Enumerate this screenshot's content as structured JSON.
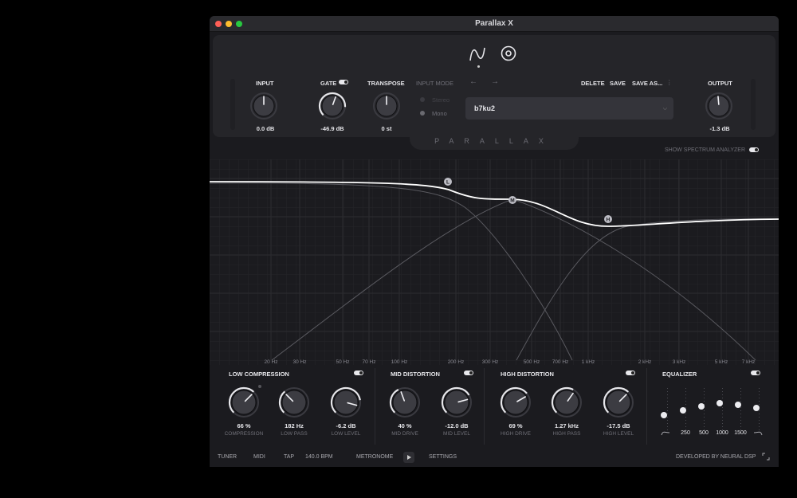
{
  "window": {
    "title": "Parallax X"
  },
  "brand": "PARALLAX",
  "header": {
    "input": {
      "label": "INPUT",
      "value": "0.0 dB"
    },
    "gate": {
      "label": "GATE",
      "value": "-46.9 dB",
      "enabled": true
    },
    "transpose": {
      "label": "TRANSPOSE",
      "value": "0 st"
    },
    "input_mode": {
      "label": "INPUT MODE",
      "options": [
        "Stereo",
        "Mono"
      ],
      "selected": "Mono"
    },
    "nav": {
      "back": "←",
      "forward": "→"
    },
    "actions": {
      "delete": "DELETE",
      "save": "SAVE",
      "save_as": "SAVE AS...",
      "more": "⋮"
    },
    "preset": {
      "name": "b7ku2"
    },
    "output": {
      "label": "OUTPUT",
      "value": "-1.3 dB"
    }
  },
  "analyzer": {
    "show_spectrum_label": "SHOW SPECTRUM ANALYZER",
    "show_spectrum_enabled": true,
    "freq_labels": [
      "20 Hz",
      "30 Hz",
      "50 Hz",
      "70 Hz",
      "100 Hz",
      "200 Hz",
      "300 Hz",
      "500 Hz",
      "700 Hz",
      "1 kHz",
      "2 kHz",
      "3 kHz",
      "5 kHz",
      "7 kHz"
    ],
    "band_markers": [
      "L",
      "M",
      "H"
    ]
  },
  "sections": {
    "low": {
      "title": "LOW COMPRESSION",
      "enabled": true,
      "knobs": [
        {
          "value": "66 %",
          "label": "COMPRESSION"
        },
        {
          "value": "182 Hz",
          "label": "LOW PASS"
        },
        {
          "value": "-6.2 dB",
          "label": "LOW LEVEL"
        }
      ]
    },
    "mid": {
      "title": "MID DISTORTION",
      "enabled": true,
      "knobs": [
        {
          "value": "40 %",
          "label": "MID DRIVE"
        },
        {
          "value": "-12.0 dB",
          "label": "MID LEVEL"
        }
      ]
    },
    "high": {
      "title": "HIGH DISTORTION",
      "enabled": true,
      "knobs": [
        {
          "value": "69 %",
          "label": "HIGH DRIVE"
        },
        {
          "value": "1.27 kHz",
          "label": "HIGH PASS"
        },
        {
          "value": "-17.5 dB",
          "label": "HIGH LEVEL"
        }
      ]
    },
    "eq": {
      "title": "EQUALIZER",
      "enabled": true,
      "bands": [
        "250",
        "500",
        "1000",
        "1500"
      ],
      "low_shelf_icon": "low-cut-icon",
      "high_shelf_icon": "high-cut-icon"
    }
  },
  "footer": {
    "tuner": "TUNER",
    "midi": "MIDI",
    "tap": "TAP",
    "bpm": "140.0 BPM",
    "metronome": "METRONOME",
    "settings": "SETTINGS",
    "developer": "DEVELOPED BY NEURAL DSP"
  },
  "colors": {
    "background": "#1b1b1f",
    "panel": "#252529",
    "accent": "#e6e6ea",
    "curve": "#ffffff"
  }
}
